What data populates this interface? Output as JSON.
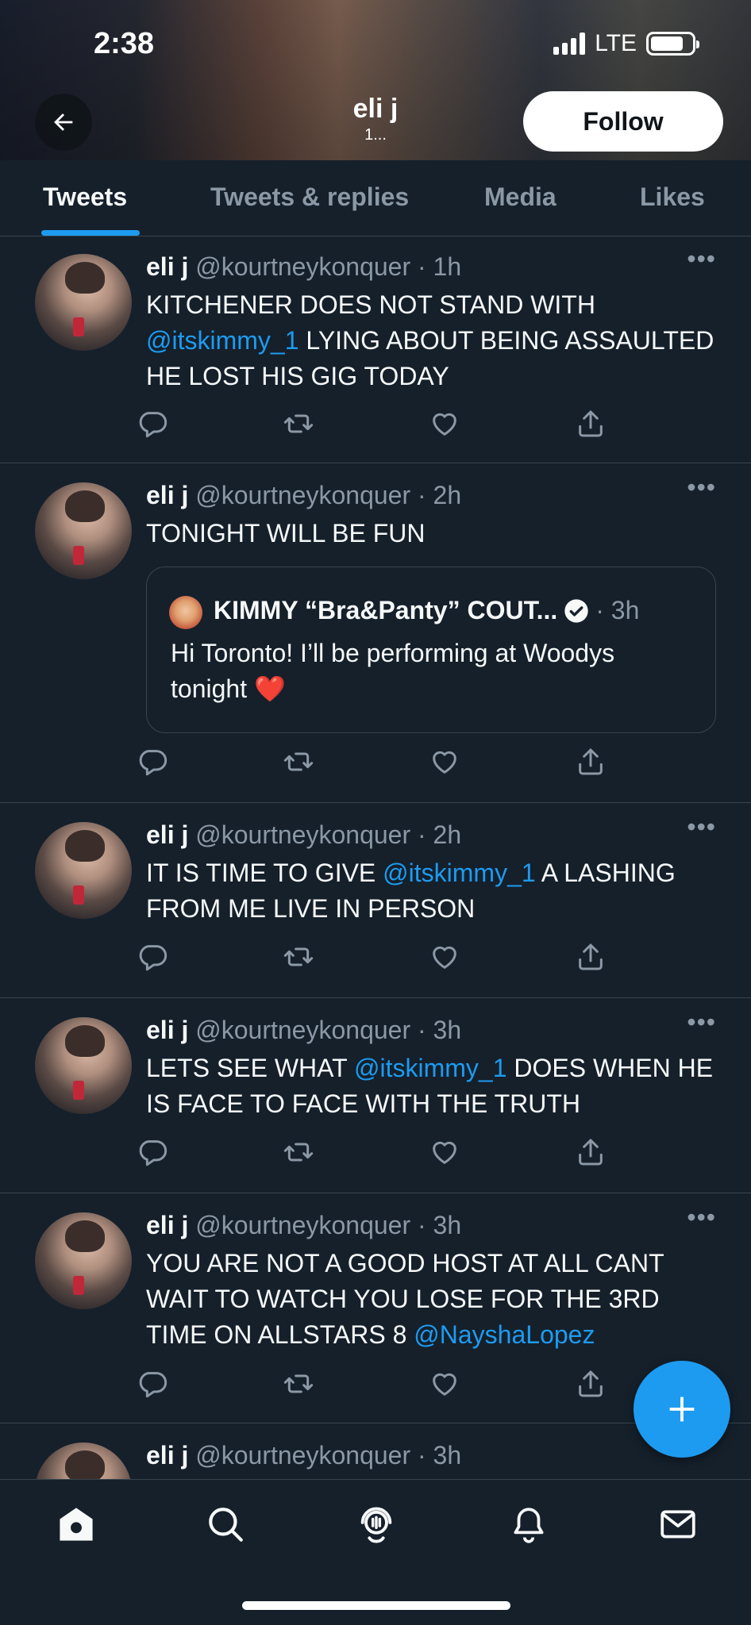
{
  "status_bar": {
    "time": "2:38",
    "network": "LTE"
  },
  "profile": {
    "name": "eli j",
    "count": "1...",
    "follow_label": "Follow"
  },
  "tabs": [
    {
      "label": "Tweets",
      "active": true
    },
    {
      "label": "Tweets & replies",
      "active": false
    },
    {
      "label": "Media",
      "active": false
    },
    {
      "label": "Likes",
      "active": false
    }
  ],
  "tweets": [
    {
      "name": "eli j",
      "handle": "@kourtneykonquer",
      "time": "· 1h",
      "text_parts": [
        {
          "t": "KITCHENER DOES NOT STAND WITH "
        },
        {
          "t": "@itskimmy_1",
          "mention": true
        },
        {
          "t": " LYING ABOUT BEING ASSAULTED HE LOST HIS GIG TODAY"
        }
      ]
    },
    {
      "name": "eli j",
      "handle": "@kourtneykonquer",
      "time": "· 2h",
      "text_parts": [
        {
          "t": "TONIGHT WILL BE FUN"
        }
      ],
      "quote": {
        "name": "KIMMY “Bra&Panty” COUT...",
        "time": "· 3h",
        "text": "Hi Toronto! I’ll be performing at Woodys tonight ❤️"
      }
    },
    {
      "name": "eli j",
      "handle": "@kourtneykonquer",
      "time": "· 2h",
      "text_parts": [
        {
          "t": "IT IS TIME TO GIVE "
        },
        {
          "t": "@itskimmy_1",
          "mention": true
        },
        {
          "t": " A LASHING FROM ME LIVE IN PERSON"
        }
      ]
    },
    {
      "name": "eli j",
      "handle": "@kourtneykonquer",
      "time": "· 3h",
      "text_parts": [
        {
          "t": "LETS SEE WHAT "
        },
        {
          "t": "@itskimmy_1",
          "mention": true
        },
        {
          "t": " DOES WHEN HE IS FACE TO FACE WITH THE TRUTH"
        }
      ]
    },
    {
      "name": "eli j",
      "handle": "@kourtneykonquer",
      "time": "· 3h",
      "text_parts": [
        {
          "t": "YOU ARE NOT A GOOD HOST AT ALL CANT WAIT TO WATCH YOU LOSE FOR THE 3RD TIME ON ALLSTARS 8 "
        },
        {
          "t": "@NayshaLopez",
          "mention": true
        }
      ]
    },
    {
      "name": "eli j",
      "handle": "@kourtneykonquer",
      "time": "· 3h",
      "text_parts": []
    }
  ],
  "icons": {
    "back": "arrow-left-icon",
    "more": "more-dots-icon",
    "reply": "reply-icon",
    "retweet": "retweet-icon",
    "like": "heart-icon",
    "share": "share-icon",
    "verified": "verified-badge-icon",
    "compose": "plus-icon",
    "nav": [
      "home-icon",
      "search-icon",
      "spaces-icon",
      "notifications-icon",
      "messages-icon"
    ]
  },
  "colors": {
    "background": "#15202b",
    "accent": "#1d9bf0",
    "muted": "#8b98a5",
    "divider": "#38444d"
  }
}
